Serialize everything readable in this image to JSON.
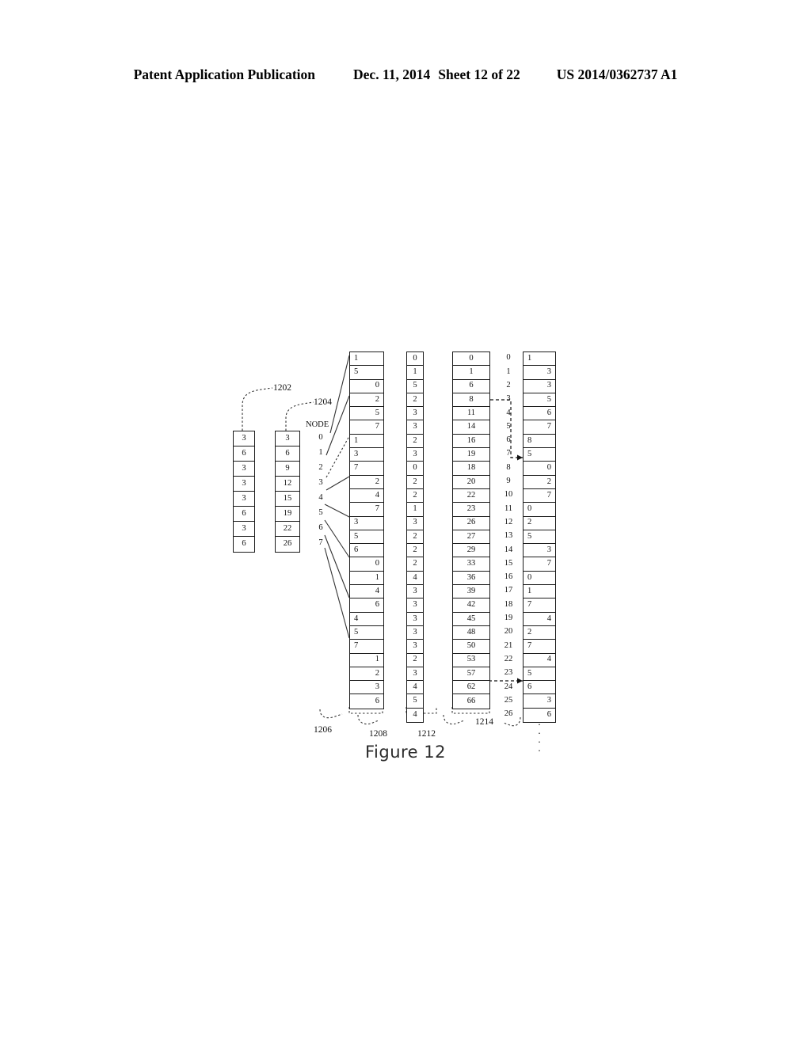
{
  "header": {
    "publication": "Patent Application Publication",
    "date": "Dec. 11, 2014",
    "sheet": "Sheet 12 of 22",
    "patent_number": "US 2014/0362737 A1"
  },
  "figure": {
    "caption": "Figure 12",
    "node_header": "NODE",
    "refs": {
      "r1202": "1202",
      "r1204": "1204",
      "r1206": "1206",
      "r1208": "1208",
      "r1212": "1212",
      "r1214": "1214"
    },
    "ellipsis": "."
  },
  "columns": {
    "col_1202": {
      "ref": "1202",
      "values": [
        "3",
        "6",
        "3",
        "3",
        "3",
        "6",
        "3",
        "6"
      ]
    },
    "col_1204": {
      "ref": "1204",
      "values": [
        "3",
        "6",
        "9",
        "12",
        "15",
        "19",
        "22",
        "26"
      ]
    },
    "col_node": {
      "ref": "1206",
      "header": "NODE",
      "values": [
        "0",
        "1",
        "2",
        "3",
        "4",
        "5",
        "6",
        "7"
      ]
    },
    "col_1208": {
      "ref": "1208",
      "values": [
        "1",
        "5",
        "0",
        "2",
        "5",
        "7",
        "1",
        "3",
        "7",
        "2",
        "4",
        "7",
        "3",
        "5",
        "6",
        "0",
        "1",
        "4",
        "6",
        "4",
        "5",
        "7",
        "1",
        "2",
        "3",
        "6"
      ],
      "align": [
        "lft",
        "lft",
        "rgt",
        "rgt",
        "rgt",
        "rgt",
        "lft",
        "lft",
        "lft",
        "rgt",
        "rgt",
        "rgt",
        "lft",
        "lft",
        "lft",
        "rgt",
        "rgt",
        "rgt",
        "rgt",
        "lft",
        "lft",
        "lft",
        "rgt",
        "rgt",
        "rgt",
        "rgt"
      ]
    },
    "col_1210": {
      "values": [
        "0",
        "1",
        "5",
        "2",
        "3",
        "3",
        "2",
        "3",
        "0",
        "2",
        "2",
        "1",
        "3",
        "2",
        "2",
        "2",
        "4",
        "3",
        "3",
        "3",
        "3",
        "3",
        "2",
        "3",
        "4",
        "5",
        "4"
      ]
    },
    "col_1212": {
      "ref": "1212",
      "values": [
        "0",
        "1",
        "6",
        "8",
        "11",
        "14",
        "16",
        "19",
        "18",
        "20",
        "22",
        "23",
        "26",
        "27",
        "29",
        "33",
        "36",
        "39",
        "42",
        "45",
        "48",
        "50",
        "53",
        "57",
        "62",
        "66"
      ]
    },
    "col_index": {
      "values": [
        "0",
        "1",
        "2",
        "3",
        "4",
        "5",
        "6",
        "7",
        "8",
        "9",
        "10",
        "11",
        "12",
        "13",
        "14",
        "15",
        "16",
        "17",
        "18",
        "19",
        "20",
        "21",
        "22",
        "23",
        "24",
        "25",
        "26"
      ]
    },
    "col_1214": {
      "ref": "1214",
      "values": [
        "1",
        "3",
        "3",
        "5",
        "6",
        "7",
        "8",
        "5",
        "0",
        "2",
        "7",
        "0",
        "2",
        "5",
        "3",
        "7",
        "0",
        "1",
        "7",
        "4",
        "2",
        "7",
        "4",
        "5",
        "6",
        "3",
        "6"
      ],
      "align": [
        "lft",
        "rgt",
        "rgt",
        "rgt",
        "rgt",
        "rgt",
        "lft",
        "lft",
        "rgt",
        "rgt",
        "rgt",
        "lft",
        "lft",
        "lft",
        "rgt",
        "rgt",
        "lft",
        "lft",
        "lft",
        "rgt",
        "lft",
        "lft",
        "rgt",
        "lft",
        "lft",
        "rgt",
        "rgt"
      ]
    }
  }
}
